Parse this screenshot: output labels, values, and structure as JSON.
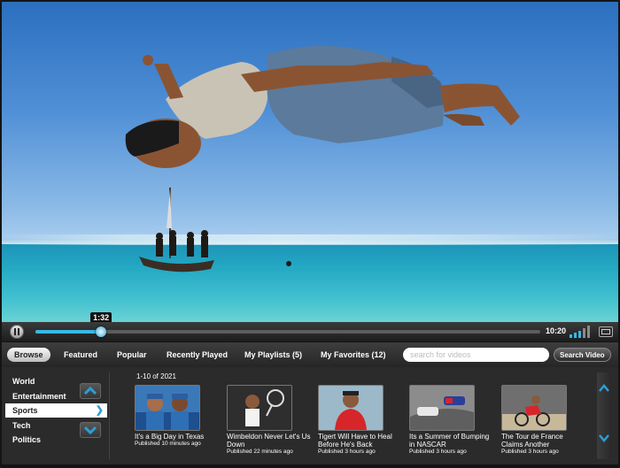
{
  "video": {
    "current_time": "1:32",
    "duration": "10:20",
    "progress": 0.13
  },
  "controls": {
    "pause_icon": "pause-icon",
    "volume_icon": "volume-bars-icon",
    "fullscreen_icon": "fullscreen-icon"
  },
  "nav": {
    "tabs": [
      {
        "label": "Browse",
        "active": true
      },
      {
        "label": "Featured"
      },
      {
        "label": "Popular"
      },
      {
        "label": "Recently Played"
      },
      {
        "label": "My Playlists (5)"
      },
      {
        "label": "My Favorites (12)"
      }
    ],
    "search_placeholder": "search for videos",
    "search_button": "Search Video"
  },
  "categories": [
    {
      "label": "World"
    },
    {
      "label": "Entertainment"
    },
    {
      "label": "Sports",
      "active": true
    },
    {
      "label": "Tech"
    },
    {
      "label": "Politics"
    }
  ],
  "results_range": "1-10 of 2021",
  "videos": [
    {
      "title": "It's a Big Day in Texas",
      "meta": "Published 10 minutes ago"
    },
    {
      "title": "Wimbeldon Never Let's Us Down",
      "meta": "Published 22 minutes ago"
    },
    {
      "title": "Tigert Will Have to Heal Before He's Back",
      "meta": "Published 3 hours ago"
    },
    {
      "title": "Its a Summer of Bumping in NASCAR",
      "meta": "Published 3 hours ago"
    },
    {
      "title": "The Tour de France Claims Another",
      "meta": "Published 3 hours ago"
    }
  ],
  "colors": {
    "accent": "#2a9fd6",
    "track_fill": "#37b7e6"
  }
}
